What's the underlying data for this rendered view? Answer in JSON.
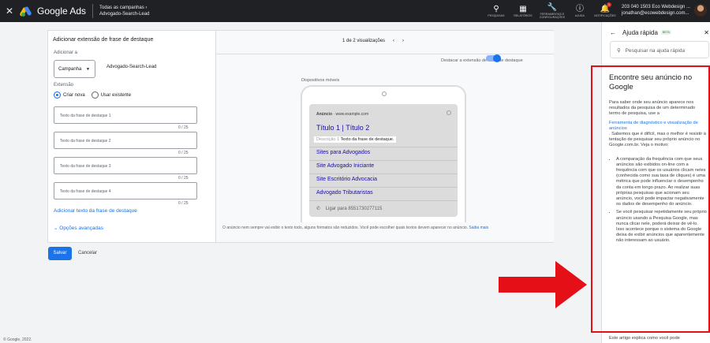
{
  "topbar": {
    "close_symbol": "✕",
    "brand": "Google Ads",
    "account_line1": "Todas as campanhas ›",
    "account_line2": "Advogado-Search-Lead",
    "icons": [
      {
        "label": "PESQUISAS",
        "icon": "search-icon"
      },
      {
        "label": "RELATÓRIOS",
        "icon": "reports-icon"
      },
      {
        "label": "FERRAMENTAS E CONFIGURAÇÕES",
        "icon": "tools-icon"
      },
      {
        "label": "AJUDA",
        "icon": "help-icon"
      },
      {
        "label": "NOTIFICAÇÕES",
        "icon": "bell-icon",
        "badge": "1"
      }
    ],
    "user_line1": "203 040 1503 Eco Webdesign ...",
    "user_line2": "jonathan@ecowebdesign.com..."
  },
  "editor": {
    "title": "Adicionar extensão de frase de destaque",
    "add_to_label": "Adicionar a",
    "level_select": "Campanha",
    "campaign_name": "Advogado-Search-Lead",
    "extension_label": "Extensão",
    "radio_new": "Criar nova",
    "radio_existing": "Usar existente",
    "fields": [
      {
        "placeholder": "Texto da frase de destaque 1",
        "count": "0 / 25"
      },
      {
        "placeholder": "Texto da frase de destaque 2",
        "count": "0 / 25"
      },
      {
        "placeholder": "Texto da frase de destaque 3",
        "count": "0 / 25"
      },
      {
        "placeholder": "Texto da frase de destaque 4",
        "count": "0 / 25"
      }
    ],
    "add_link": "Adicionar texto da frase de destaque",
    "advanced": "Opções avançadas"
  },
  "preview": {
    "pager": "1 de 2 visualizações",
    "highlight_toggle": "Destacar a extensão de frase de destaque",
    "device": "Dispositivos móveis",
    "ad_label": "Anúncio",
    "ad_url": "· www.example.com",
    "headline": "Título 1 | Título 2",
    "desc_placeholder": "Descrição 1",
    "desc_callout": "Texto da frase de destaque.",
    "sitelinks": [
      "Sites para Advogados",
      "Site Advogado Iniciante",
      "Site Escritório Advocacia",
      "Advogado Tributaristas"
    ],
    "call": "Ligar para 8551730277115",
    "note": "O anúncio nem sempre vai exibir o texto todo, alguns formatos são reduzidos. Você pode escolher quais textos devem aparecer no anúncio.",
    "note_link": "Saiba mais"
  },
  "actions": {
    "save": "Salvar",
    "cancel": "Cancelar"
  },
  "footer": "© Google, 2022.",
  "help": {
    "back_symbol": "←",
    "title": "Ajuda rápida",
    "beta": "BETA",
    "close_symbol": "✕",
    "search_placeholder": "Pesquisar na ajuda rápida",
    "article_title": "Encontre seu anúncio no Google",
    "intro": "Para saber onde seu anúncio aparece nos resultados da pesquisa de um determinado termo de pesquisa, use a",
    "tool_link": "Ferramenta de diagnóstico e visualização de anúncios",
    "intro2": ". Sabemos que é difícil, mas o melhor é resistir à tentação de pesquisar seu próprio anúncio no Google.com.br. Veja o motivo:",
    "bullets": [
      "A comparação da frequência com que seus anúncios são exibidos on-line com a frequência com que os usuários clicam neles (conhecida como sua taxa de cliques) é uma métrica que pode influenciar o desempenho da conta em longo prazo. Ao realizar suas próprias pesquisas que acionam seu anúncio, você pode impactar negativamente os dados de desempenho do anúncio.",
      "Se você pesquisar repetidamente seu próprio anúncio usando a Pesquisa Google, mas nunca clicar nele, poderá deixar de vê-lo. Isso acontece porque o sistema do Google deixa de exibir anúncios que aparentemente não interessam ao usuário."
    ],
    "after": "Este artigo explica como você pode"
  },
  "colors": {
    "accent": "#1a73e8",
    "highlight_border": "#e50f18",
    "arrow": "#e50f18"
  }
}
